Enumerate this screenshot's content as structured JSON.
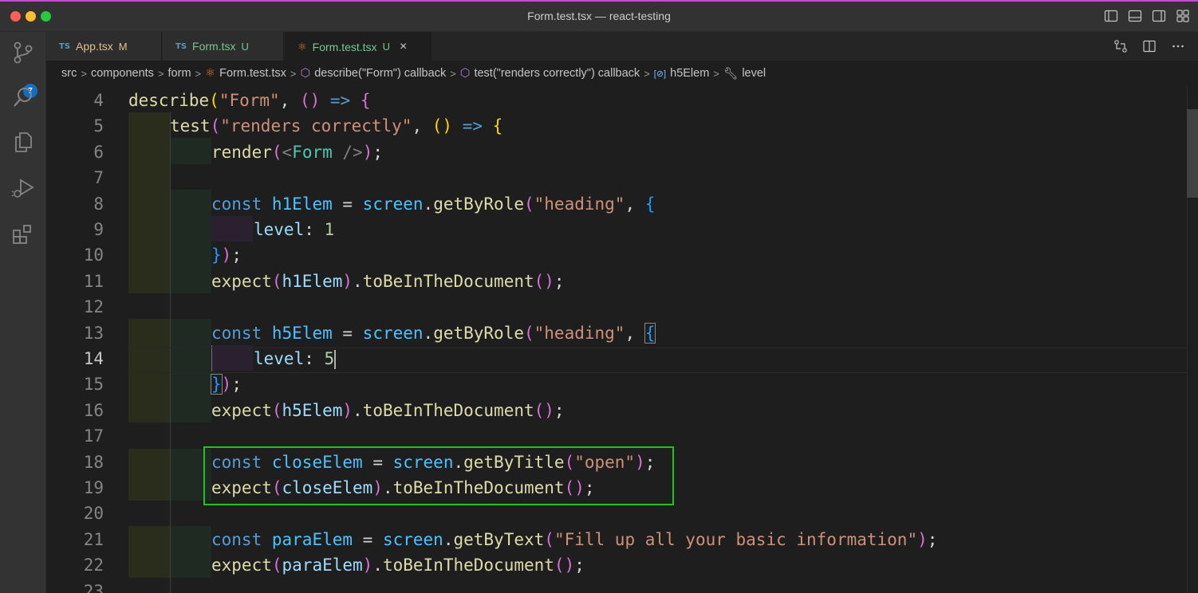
{
  "window": {
    "title": "Form.test.tsx — react-testing"
  },
  "activity_bar": {
    "items": [
      {
        "name": "source-control",
        "icon": "source-control-icon",
        "badge": "7"
      },
      {
        "name": "search",
        "icon": "search-icon"
      },
      {
        "name": "explorer",
        "icon": "files-icon"
      },
      {
        "name": "run-debug",
        "icon": "run-debug-icon"
      },
      {
        "name": "extensions",
        "icon": "extensions-icon"
      }
    ]
  },
  "tabs": [
    {
      "lang": "TS",
      "label": "App.tsx",
      "status": "M",
      "active": false
    },
    {
      "lang": "TS",
      "label": "Form.tsx",
      "status": "U",
      "active": false
    },
    {
      "lang": "react-icon",
      "label": "Form.test.tsx",
      "status": "U",
      "active": true,
      "close": "×"
    }
  ],
  "breadcrumb": {
    "items": [
      "src",
      "components",
      "form",
      "Form.test.tsx",
      "describe(\"Form\") callback",
      "test(\"renders correctly\") callback",
      "h5Elem",
      "level"
    ]
  },
  "editor": {
    "current_line": 14,
    "lines": [
      {
        "n": "4"
      },
      {
        "n": "5"
      },
      {
        "n": "6"
      },
      {
        "n": "7"
      },
      {
        "n": "8"
      },
      {
        "n": "9"
      },
      {
        "n": "10"
      },
      {
        "n": "11"
      },
      {
        "n": "12"
      },
      {
        "n": "13"
      },
      {
        "n": "14"
      },
      {
        "n": "15"
      },
      {
        "n": "16"
      },
      {
        "n": "17"
      },
      {
        "n": "18"
      },
      {
        "n": "19"
      },
      {
        "n": "20"
      },
      {
        "n": "21"
      },
      {
        "n": "22"
      },
      {
        "n": "23"
      }
    ],
    "code": {
      "l4": [
        "describe",
        "(",
        "\"Form\"",
        ", ",
        "()",
        " => ",
        "{"
      ],
      "l5": [
        "test",
        "(",
        "\"renders correctly\"",
        ", ",
        "()",
        " => ",
        "{"
      ],
      "l6": [
        "render",
        "(",
        "<",
        "Form",
        " />",
        ")",
        ";"
      ],
      "l8": [
        "const",
        " ",
        "h1Elem",
        " = ",
        "screen",
        ".",
        "getByRole",
        "(",
        "\"heading\"",
        ", ",
        "{"
      ],
      "l9": [
        "level",
        ": ",
        "1"
      ],
      "l10": [
        "}",
        ")",
        ";"
      ],
      "l11": [
        "expect",
        "(",
        "h1Elem",
        ")",
        ".",
        "toBeInTheDocument",
        "()",
        ";"
      ],
      "l13": [
        "const",
        " ",
        "h5Elem",
        " = ",
        "screen",
        ".",
        "getByRole",
        "(",
        "\"heading\"",
        ", ",
        "{"
      ],
      "l14": [
        "level",
        ": ",
        "5"
      ],
      "l15": [
        "}",
        ")",
        ";"
      ],
      "l16": [
        "expect",
        "(",
        "h5Elem",
        ")",
        ".",
        "toBeInTheDocument",
        "()",
        ";"
      ],
      "l18": [
        "const",
        " ",
        "closeElem",
        " = ",
        "screen",
        ".",
        "getByTitle",
        "(",
        "\"open\"",
        ")",
        ";"
      ],
      "l19": [
        "expect",
        "(",
        "closeElem",
        ")",
        ".",
        "toBeInTheDocument",
        "()",
        ";"
      ],
      "l21": [
        "const",
        " ",
        "paraElem",
        " = ",
        "screen",
        ".",
        "getByText",
        "(",
        "\"Fill up all your basic information\"",
        ")",
        ";"
      ],
      "l22": [
        "expect",
        "(",
        "paraElem",
        ")",
        ".",
        "toBeInTheDocument",
        "()",
        ";"
      ]
    }
  },
  "colors": {
    "highlight_box": "#1ec41e",
    "accent": "#0e70c0"
  }
}
